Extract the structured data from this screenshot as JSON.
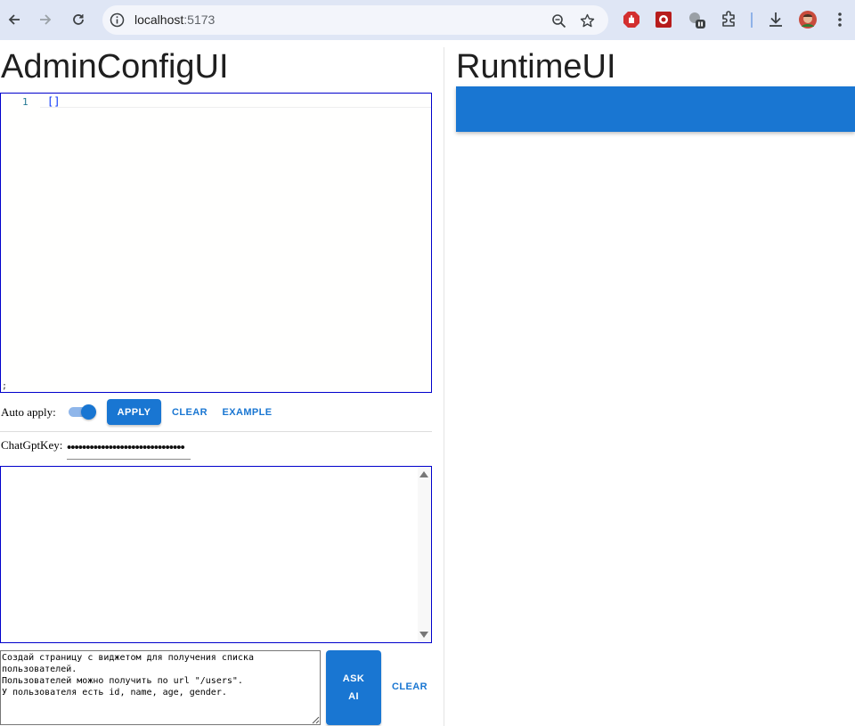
{
  "browser": {
    "url_host": "localhost",
    "url_port": ":5173",
    "extensions": [
      "adblock-icon",
      "red-extension-icon",
      "paused-extension-icon",
      "puzzle-icon"
    ]
  },
  "admin": {
    "title": "AdminConfigUI",
    "editor": {
      "line_number": "1",
      "code": "[]",
      "tail": ";"
    },
    "auto_apply_label": "Auto apply:",
    "auto_apply_on": true,
    "apply_label": "APPLY",
    "clear_label": "CLEAR",
    "example_label": "EXAMPLE",
    "chatgpt_key_label": "ChatGptKey:",
    "chatgpt_key_value": "•••••••••••••••••••••••••••••••",
    "chat_output": "",
    "prompt_text": "Создай страницу с виджетом для получения списка\nпользователей.\nПользователей можно получить по url \"/users\".\nУ пользователя есть id, name, age, gender.",
    "ask_ai_line1": "ASK",
    "ask_ai_line2": "AI",
    "prompt_clear_label": "CLEAR"
  },
  "runtime": {
    "title": "RuntimeUI"
  },
  "colors": {
    "primary": "#1976d2",
    "chrome": "#dfe6f5",
    "editor_border": "#0000cc"
  }
}
